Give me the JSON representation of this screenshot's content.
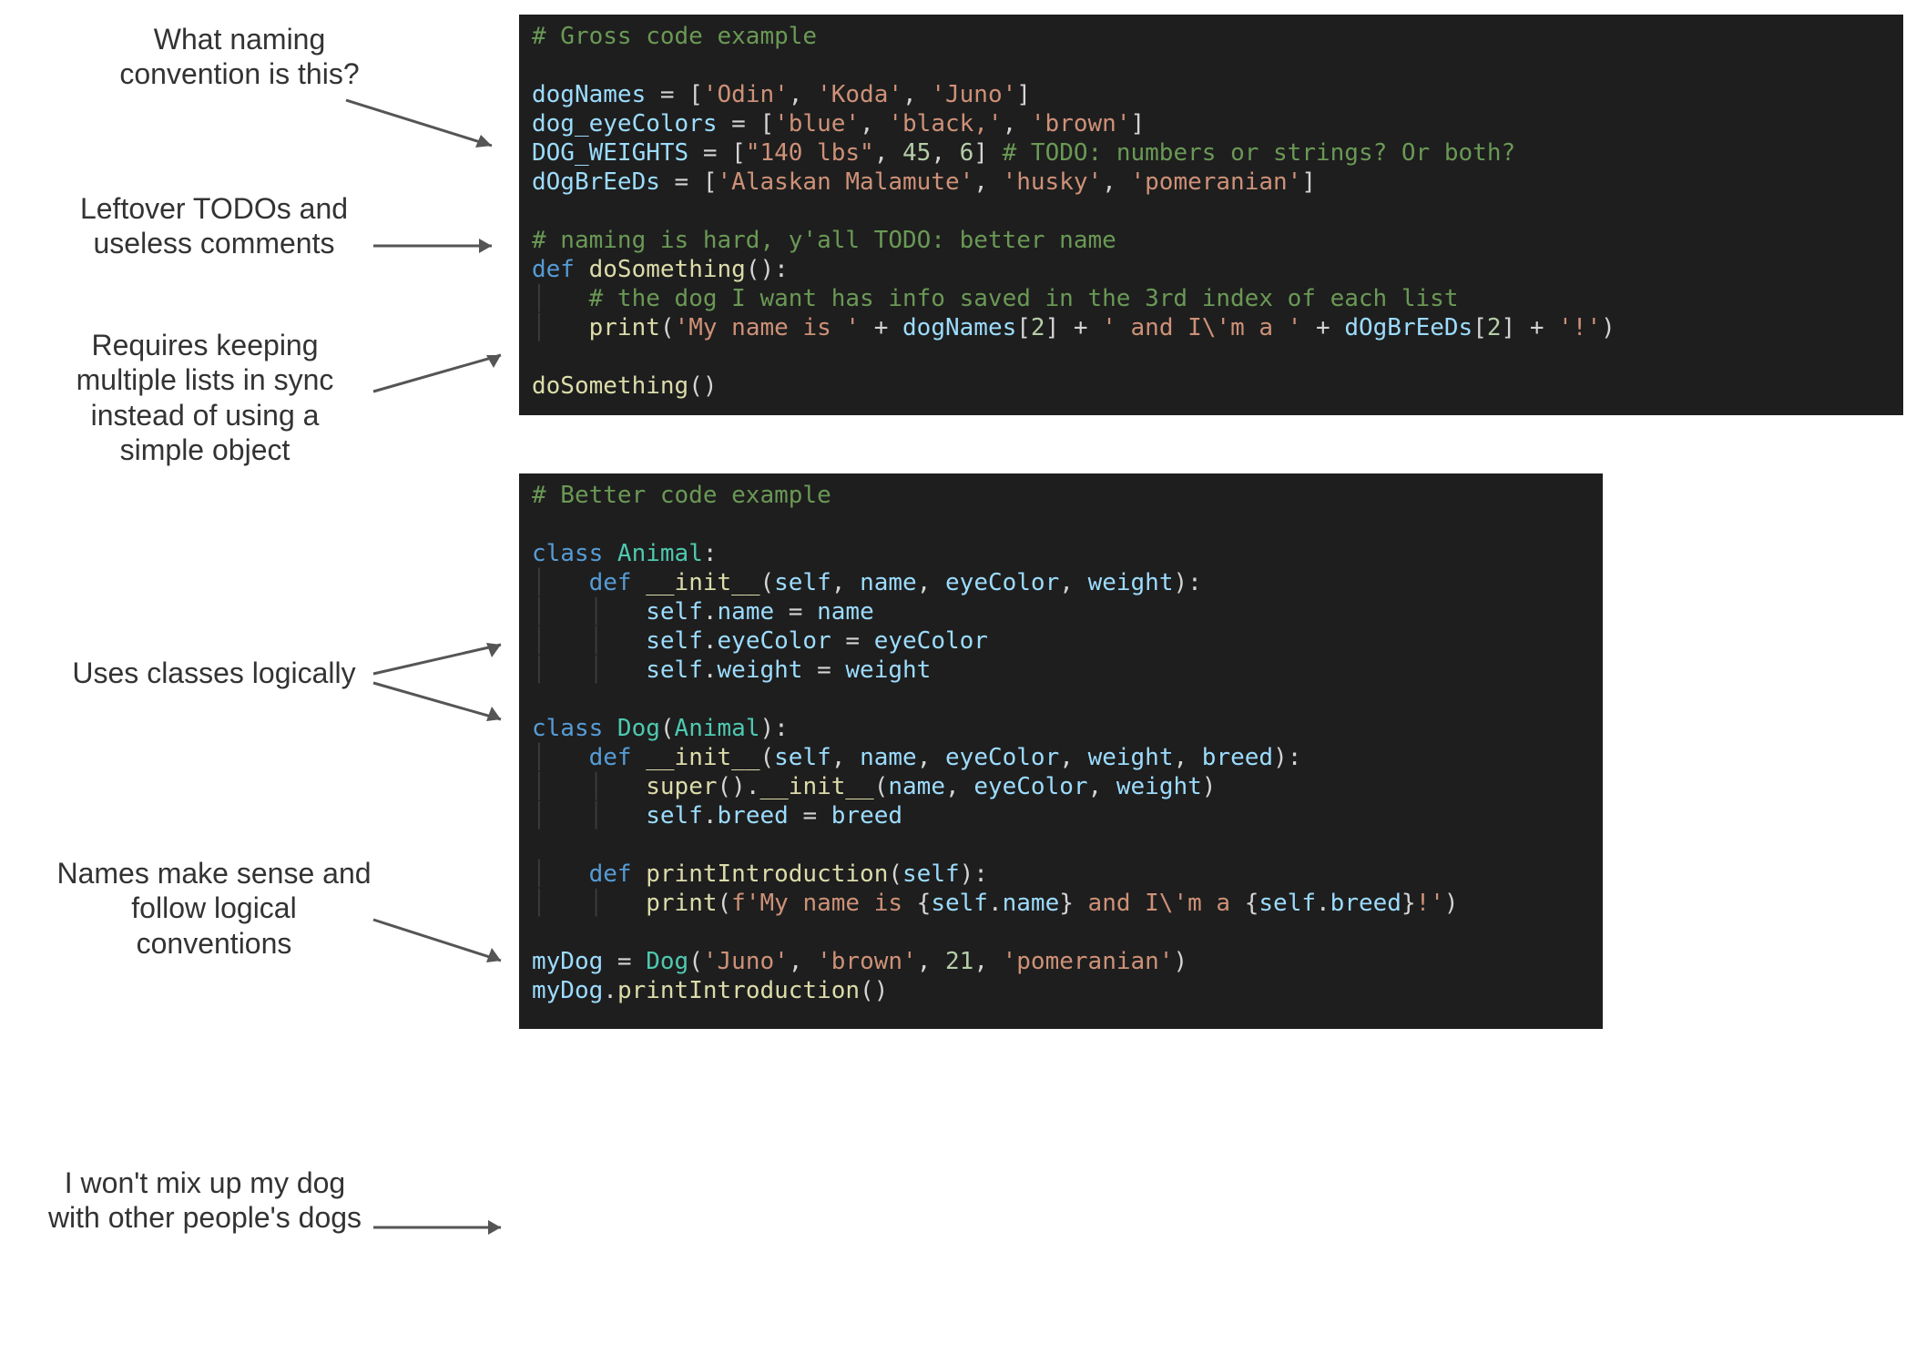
{
  "annotations": {
    "a1": "What naming convention is this?",
    "a2": "Leftover TODOs and useless comments",
    "a3": "Requires keeping multiple lists in sync instead of using a simple object",
    "a4": "Uses classes logically",
    "a5": "Names make sense and follow logical conventions",
    "a6": "I won't mix up my dog with other people's dogs"
  },
  "colors": {
    "editor_bg": "#1e1e1e",
    "comment": "#6a9955",
    "keyword": "#569cd6",
    "string": "#ce9178",
    "number": "#b5cea8",
    "identifier": "#9cdcfe",
    "function": "#dcdcaa",
    "class": "#4ec9b0"
  },
  "code": {
    "gross": [
      [
        {
          "t": "# Gross code example",
          "c": "comment"
        }
      ],
      [],
      [
        {
          "t": "dogNames",
          "c": "ident"
        },
        {
          "t": " = [",
          "c": "punct"
        },
        {
          "t": "'Odin'",
          "c": "string"
        },
        {
          "t": ", ",
          "c": "punct"
        },
        {
          "t": "'Koda'",
          "c": "string"
        },
        {
          "t": ", ",
          "c": "punct"
        },
        {
          "t": "'Juno'",
          "c": "string"
        },
        {
          "t": "]",
          "c": "punct"
        }
      ],
      [
        {
          "t": "dog_eyeColors",
          "c": "ident"
        },
        {
          "t": " = [",
          "c": "punct"
        },
        {
          "t": "'blue'",
          "c": "string"
        },
        {
          "t": ", ",
          "c": "punct"
        },
        {
          "t": "'black,'",
          "c": "string"
        },
        {
          "t": ", ",
          "c": "punct"
        },
        {
          "t": "'brown'",
          "c": "string"
        },
        {
          "t": "]",
          "c": "punct"
        }
      ],
      [
        {
          "t": "DOG_WEIGHTS",
          "c": "ident"
        },
        {
          "t": " = [",
          "c": "punct"
        },
        {
          "t": "\"140 lbs\"",
          "c": "string"
        },
        {
          "t": ", ",
          "c": "punct"
        },
        {
          "t": "45",
          "c": "number"
        },
        {
          "t": ", ",
          "c": "punct"
        },
        {
          "t": "6",
          "c": "number"
        },
        {
          "t": "] ",
          "c": "punct"
        },
        {
          "t": "# TODO: numbers or strings? Or both?",
          "c": "comment"
        }
      ],
      [
        {
          "t": "dOgBrEeDs",
          "c": "ident"
        },
        {
          "t": " = [",
          "c": "punct"
        },
        {
          "t": "'Alaskan Malamute'",
          "c": "string"
        },
        {
          "t": ", ",
          "c": "punct"
        },
        {
          "t": "'husky'",
          "c": "string"
        },
        {
          "t": ", ",
          "c": "punct"
        },
        {
          "t": "'pomeranian'",
          "c": "string"
        },
        {
          "t": "]",
          "c": "punct"
        }
      ],
      [],
      [
        {
          "t": "# naming is hard, y'all TODO: better name",
          "c": "comment"
        }
      ],
      [
        {
          "t": "def ",
          "c": "keyword"
        },
        {
          "t": "doSomething",
          "c": "func"
        },
        {
          "t": "():",
          "c": "punct"
        }
      ],
      [
        {
          "t": "    ",
          "c": "indent"
        },
        {
          "t": "# the dog I want has info saved in the 3rd index of each list",
          "c": "comment"
        }
      ],
      [
        {
          "t": "    ",
          "c": "indent"
        },
        {
          "t": "print",
          "c": "func"
        },
        {
          "t": "(",
          "c": "punct"
        },
        {
          "t": "'My name is '",
          "c": "string"
        },
        {
          "t": " + ",
          "c": "punct"
        },
        {
          "t": "dogNames",
          "c": "ident"
        },
        {
          "t": "[",
          "c": "punct"
        },
        {
          "t": "2",
          "c": "number"
        },
        {
          "t": "] + ",
          "c": "punct"
        },
        {
          "t": "' and I\\'m a '",
          "c": "string"
        },
        {
          "t": " + ",
          "c": "punct"
        },
        {
          "t": "dOgBrEeDs",
          "c": "ident"
        },
        {
          "t": "[",
          "c": "punct"
        },
        {
          "t": "2",
          "c": "number"
        },
        {
          "t": "] + ",
          "c": "punct"
        },
        {
          "t": "'!'",
          "c": "string"
        },
        {
          "t": ")",
          "c": "punct"
        }
      ],
      [],
      [
        {
          "t": "doSomething",
          "c": "func"
        },
        {
          "t": "()",
          "c": "punct"
        }
      ]
    ],
    "better": [
      [
        {
          "t": "# Better code example",
          "c": "comment"
        }
      ],
      [],
      [
        {
          "t": "class ",
          "c": "keyword"
        },
        {
          "t": "Animal",
          "c": "class"
        },
        {
          "t": ":",
          "c": "punct"
        }
      ],
      [
        {
          "t": "    ",
          "c": "indent"
        },
        {
          "t": "def ",
          "c": "keyword"
        },
        {
          "t": "__init__",
          "c": "func"
        },
        {
          "t": "(",
          "c": "punct"
        },
        {
          "t": "self",
          "c": "self"
        },
        {
          "t": ", ",
          "c": "punct"
        },
        {
          "t": "name",
          "c": "ident"
        },
        {
          "t": ", ",
          "c": "punct"
        },
        {
          "t": "eyeColor",
          "c": "ident"
        },
        {
          "t": ", ",
          "c": "punct"
        },
        {
          "t": "weight",
          "c": "ident"
        },
        {
          "t": "):",
          "c": "punct"
        }
      ],
      [
        {
          "t": "        ",
          "c": "indent"
        },
        {
          "t": "self",
          "c": "self"
        },
        {
          "t": ".",
          "c": "punct"
        },
        {
          "t": "name",
          "c": "ident"
        },
        {
          "t": " = ",
          "c": "punct"
        },
        {
          "t": "name",
          "c": "ident"
        }
      ],
      [
        {
          "t": "        ",
          "c": "indent"
        },
        {
          "t": "self",
          "c": "self"
        },
        {
          "t": ".",
          "c": "punct"
        },
        {
          "t": "eyeColor",
          "c": "ident"
        },
        {
          "t": " = ",
          "c": "punct"
        },
        {
          "t": "eyeColor",
          "c": "ident"
        }
      ],
      [
        {
          "t": "        ",
          "c": "indent"
        },
        {
          "t": "self",
          "c": "self"
        },
        {
          "t": ".",
          "c": "punct"
        },
        {
          "t": "weight",
          "c": "ident"
        },
        {
          "t": " = ",
          "c": "punct"
        },
        {
          "t": "weight",
          "c": "ident"
        }
      ],
      [],
      [
        {
          "t": "class ",
          "c": "keyword"
        },
        {
          "t": "Dog",
          "c": "class"
        },
        {
          "t": "(",
          "c": "punct"
        },
        {
          "t": "Animal",
          "c": "class"
        },
        {
          "t": "):",
          "c": "punct"
        }
      ],
      [
        {
          "t": "    ",
          "c": "indent"
        },
        {
          "t": "def ",
          "c": "keyword"
        },
        {
          "t": "__init__",
          "c": "func"
        },
        {
          "t": "(",
          "c": "punct"
        },
        {
          "t": "self",
          "c": "self"
        },
        {
          "t": ", ",
          "c": "punct"
        },
        {
          "t": "name",
          "c": "ident"
        },
        {
          "t": ", ",
          "c": "punct"
        },
        {
          "t": "eyeColor",
          "c": "ident"
        },
        {
          "t": ", ",
          "c": "punct"
        },
        {
          "t": "weight",
          "c": "ident"
        },
        {
          "t": ", ",
          "c": "punct"
        },
        {
          "t": "breed",
          "c": "ident"
        },
        {
          "t": "):",
          "c": "punct"
        }
      ],
      [
        {
          "t": "        ",
          "c": "indent"
        },
        {
          "t": "super",
          "c": "func"
        },
        {
          "t": "().",
          "c": "punct"
        },
        {
          "t": "__init__",
          "c": "func"
        },
        {
          "t": "(",
          "c": "punct"
        },
        {
          "t": "name",
          "c": "ident"
        },
        {
          "t": ", ",
          "c": "punct"
        },
        {
          "t": "eyeColor",
          "c": "ident"
        },
        {
          "t": ", ",
          "c": "punct"
        },
        {
          "t": "weight",
          "c": "ident"
        },
        {
          "t": ")",
          "c": "punct"
        }
      ],
      [
        {
          "t": "        ",
          "c": "indent"
        },
        {
          "t": "self",
          "c": "self"
        },
        {
          "t": ".",
          "c": "punct"
        },
        {
          "t": "breed",
          "c": "ident"
        },
        {
          "t": " = ",
          "c": "punct"
        },
        {
          "t": "breed",
          "c": "ident"
        }
      ],
      [],
      [
        {
          "t": "    ",
          "c": "indent"
        },
        {
          "t": "def ",
          "c": "keyword"
        },
        {
          "t": "printIntroduction",
          "c": "func"
        },
        {
          "t": "(",
          "c": "punct"
        },
        {
          "t": "self",
          "c": "self"
        },
        {
          "t": "):",
          "c": "punct"
        }
      ],
      [
        {
          "t": "        ",
          "c": "indent"
        },
        {
          "t": "print",
          "c": "func"
        },
        {
          "t": "(",
          "c": "punct"
        },
        {
          "t": "f'My name is ",
          "c": "string"
        },
        {
          "t": "{",
          "c": "punct"
        },
        {
          "t": "self",
          "c": "self"
        },
        {
          "t": ".",
          "c": "punct"
        },
        {
          "t": "name",
          "c": "ident"
        },
        {
          "t": "}",
          "c": "punct"
        },
        {
          "t": " and I\\'m a ",
          "c": "string"
        },
        {
          "t": "{",
          "c": "punct"
        },
        {
          "t": "self",
          "c": "self"
        },
        {
          "t": ".",
          "c": "punct"
        },
        {
          "t": "breed",
          "c": "ident"
        },
        {
          "t": "}",
          "c": "punct"
        },
        {
          "t": "!'",
          "c": "string"
        },
        {
          "t": ")",
          "c": "punct"
        }
      ],
      [],
      [
        {
          "t": "myDog",
          "c": "ident"
        },
        {
          "t": " = ",
          "c": "punct"
        },
        {
          "t": "Dog",
          "c": "class"
        },
        {
          "t": "(",
          "c": "punct"
        },
        {
          "t": "'Juno'",
          "c": "string"
        },
        {
          "t": ", ",
          "c": "punct"
        },
        {
          "t": "'brown'",
          "c": "string"
        },
        {
          "t": ", ",
          "c": "punct"
        },
        {
          "t": "21",
          "c": "number"
        },
        {
          "t": ", ",
          "c": "punct"
        },
        {
          "t": "'pomeranian'",
          "c": "string"
        },
        {
          "t": ")",
          "c": "punct"
        }
      ],
      [
        {
          "t": "myDog",
          "c": "ident"
        },
        {
          "t": ".",
          "c": "punct"
        },
        {
          "t": "printIntroduction",
          "c": "func"
        },
        {
          "t": "()",
          "c": "punct"
        }
      ]
    ]
  }
}
